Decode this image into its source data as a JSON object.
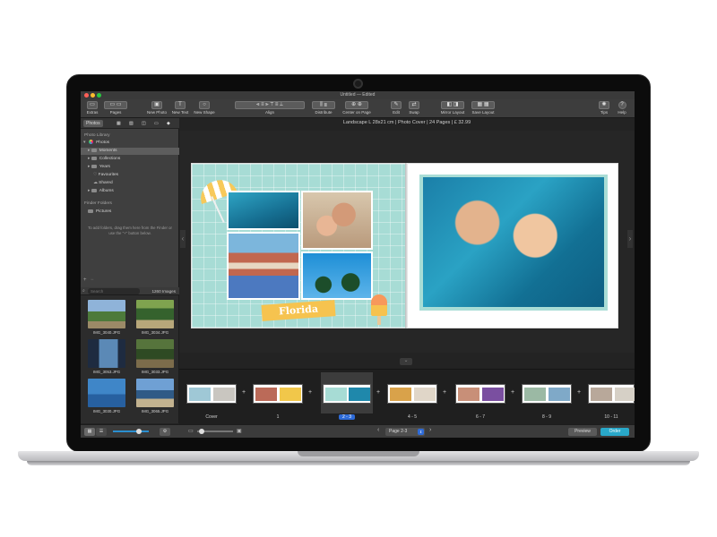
{
  "window": {
    "title": "Untitled — Edited"
  },
  "toolbar": {
    "extras": "Extras",
    "pages": "Pages",
    "new_photo": "New Photo",
    "new_text": "New Text",
    "new_shape": "New Shape",
    "align": "Align",
    "distribute": "Distribute",
    "center_on_page": "Center on Page",
    "edit": "Edit",
    "swap": "Swap",
    "mirror_layout": "Mirror Layout",
    "save_layout": "Save Layout",
    "tips": "Tips",
    "help": "Help"
  },
  "sidebar": {
    "tab_photos": "Photos",
    "photo_library_label": "Photo Library",
    "photos_root": "Photos",
    "items": [
      "Moments",
      "Collections",
      "Years",
      "Favourites",
      "Shared",
      "Albums"
    ],
    "finder_label": "Finder Folders",
    "finder_item": "Pictures",
    "hint": "To add folders, drag them here from the Finder or use the \"+\" button below."
  },
  "images": {
    "search_placeholder": "Search",
    "count": "1260 Images",
    "thumbs": [
      "IMG_3040.JPG",
      "IMG_3034.JPG",
      "IMG_3053.JPG",
      "IMG_3033.JPG",
      "IMG_3030.JPG",
      "IMG_3065.JPG"
    ]
  },
  "book": {
    "info": "Landscape L 28x21 cm  |  Photo Cover  |  24 Pages  |  £ 32.99",
    "florida": "Florida"
  },
  "pagestrip": {
    "labels": [
      "Cover",
      "1",
      "2 - 3",
      "4 - 5",
      "6 - 7",
      "8 - 9",
      "10 - 11"
    ]
  },
  "bottom": {
    "page_select": "Page 2-3",
    "preview": "Preview",
    "order": "Order"
  },
  "colors": {
    "accent": "#29a8c9",
    "selection": "#2e6bd8",
    "page_bg": "#a7dcd5",
    "florida": "#f6c34f"
  }
}
